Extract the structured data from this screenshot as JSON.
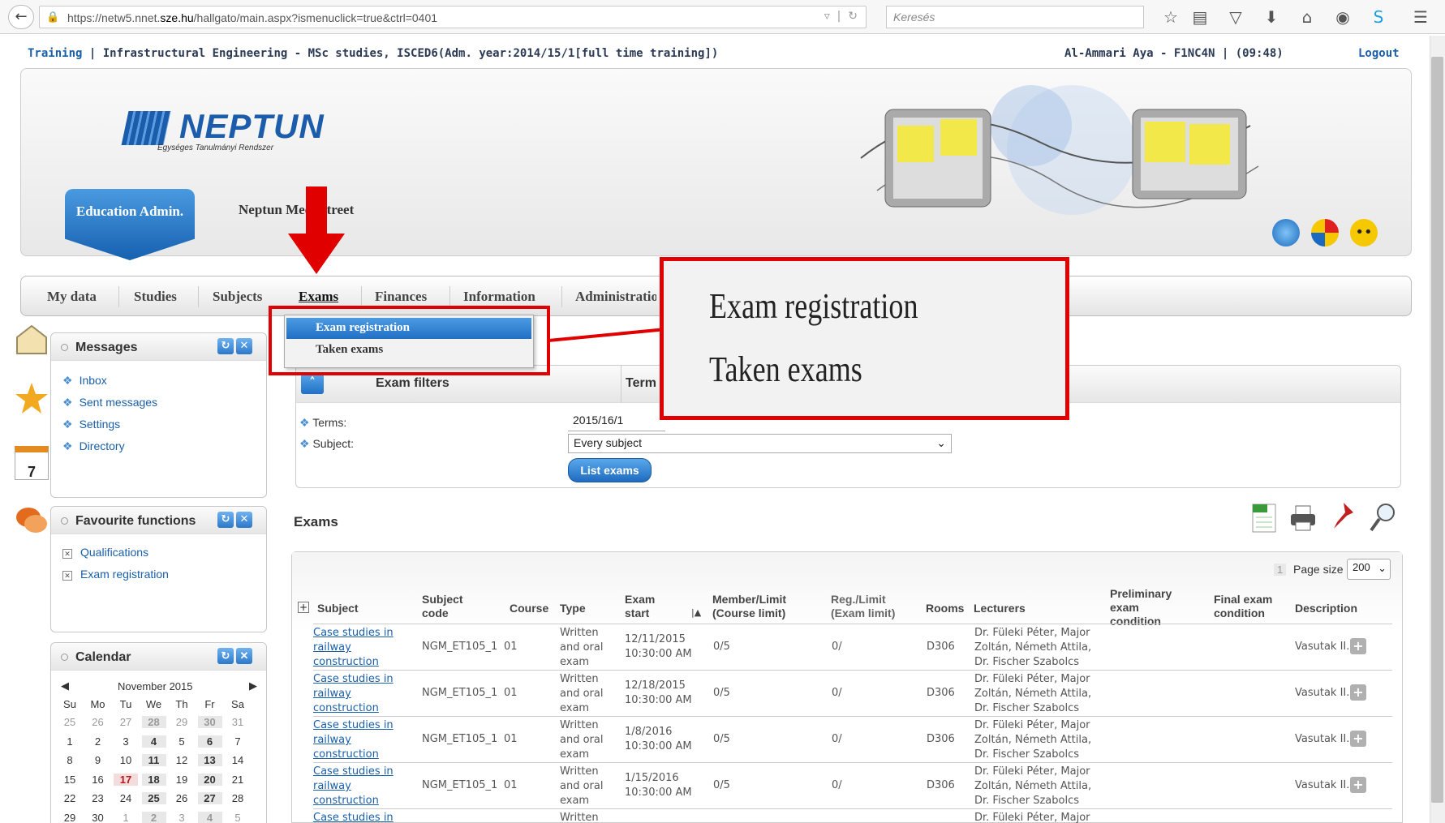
{
  "browser": {
    "url_prefix": "https://netw5.nnet.",
    "url_host": "sze.hu",
    "url_path": "/hallgato/main.aspx?ismenuclick=true&ctrl=0401",
    "search_placeholder": "Keresés"
  },
  "topinfo": {
    "training_link": "Training",
    "program": "Infrastructural Engineering - MSc studies, ISCED6(Adm. year:2014/15/1[full time training])",
    "user": "Al-Ammari Aya - F1NC4N",
    "time": "(09:48)",
    "logout": "Logout"
  },
  "header": {
    "logo": "NEPTUN",
    "logo_sub": "Egységes Tanulmányi Rendszer",
    "edu_tab": "Education Admin.",
    "meet_tab": "Neptun Meet Street"
  },
  "nav": {
    "items": [
      "My data",
      "Studies",
      "Subjects",
      "Exams",
      "Finances",
      "Information",
      "Administration"
    ],
    "dropdown": [
      "Exam registration",
      "Taken exams"
    ]
  },
  "zoom": {
    "line1": "Exam registration",
    "line2": "Taken exams"
  },
  "messages": {
    "title": "Messages",
    "links": [
      "Inbox",
      "Sent messages",
      "Settings",
      "Directory"
    ]
  },
  "favourites": {
    "title": "Favourite functions",
    "links": [
      "Qualifications",
      "Exam registration"
    ]
  },
  "calendar": {
    "title": "Calendar",
    "month": "November 2015",
    "weekdays": [
      "Su",
      "Mo",
      "Tu",
      "We",
      "Th",
      "Fr",
      "Sa"
    ],
    "weeks": [
      [
        "25",
        "26",
        "27",
        "28",
        "29",
        "30",
        "31"
      ],
      [
        "1",
        "2",
        "3",
        "4",
        "5",
        "6",
        "7"
      ],
      [
        "8",
        "9",
        "10",
        "11",
        "12",
        "13",
        "14"
      ],
      [
        "15",
        "16",
        "17",
        "18",
        "19",
        "20",
        "21"
      ],
      [
        "22",
        "23",
        "24",
        "25",
        "26",
        "27",
        "28"
      ],
      [
        "29",
        "30",
        "1",
        "2",
        "3",
        "4",
        "5"
      ]
    ],
    "side_day": "7"
  },
  "filters": {
    "title": "Exam filters",
    "term_col": "Term",
    "terms_label": "Terms:",
    "terms_value": "2015/16/1",
    "subject_label": "Subject:",
    "subject_value": "Every subject",
    "list_button": "List exams"
  },
  "exams": {
    "title": "Exams",
    "page_num": "1",
    "page_size_label": "Page size",
    "page_size_value": "200",
    "columns": [
      "Subject",
      "Subject code",
      "Course",
      "Type",
      "Exam start",
      "Member/Limit (Course limit)",
      "Reg./Limit (Exam limit)",
      "Rooms",
      "Lecturers",
      "Preliminary exam condition",
      "Final exam condition",
      "Description"
    ],
    "rows": [
      {
        "subject": "Case studies in railway construction",
        "code": "NGM_ET105_1",
        "course": "01",
        "type": "Written and oral exam",
        "start": "12/11/2015 10:30:00 AM",
        "member": "0/5",
        "reg": "0/",
        "room": "D306",
        "lecturers": "Dr. Füleki Péter, Major Zoltán, Németh Attila, Dr. Fischer Szabolcs",
        "description": "Vasutak II..."
      },
      {
        "subject": "Case studies in railway construction",
        "code": "NGM_ET105_1",
        "course": "01",
        "type": "Written and oral exam",
        "start": "12/18/2015 10:30:00 AM",
        "member": "0/5",
        "reg": "0/",
        "room": "D306",
        "lecturers": "Dr. Füleki Péter, Major Zoltán, Németh Attila, Dr. Fischer Szabolcs",
        "description": "Vasutak II..."
      },
      {
        "subject": "Case studies in railway construction",
        "code": "NGM_ET105_1",
        "course": "01",
        "type": "Written and oral exam",
        "start": "1/8/2016 10:30:00 AM",
        "member": "0/5",
        "reg": "0/",
        "room": "D306",
        "lecturers": "Dr. Füleki Péter, Major Zoltán, Németh Attila, Dr. Fischer Szabolcs",
        "description": "Vasutak II..."
      },
      {
        "subject": "Case studies in railway construction",
        "code": "NGM_ET105_1",
        "course": "01",
        "type": "Written and oral exam",
        "start": "1/15/2016 10:30:00 AM",
        "member": "0/5",
        "reg": "0/",
        "room": "D306",
        "lecturers": "Dr. Füleki Péter, Major Zoltán, Németh Attila, Dr. Fischer Szabolcs",
        "description": "Vasutak II..."
      }
    ],
    "partial_row": {
      "subject": "Case studies in",
      "type": "Written",
      "lecturers": "Dr. Füleki Péter, Major"
    }
  },
  "colors": {
    "accent": "#1b5dab",
    "highlight": "#e00000",
    "link": "#1a5fa8"
  }
}
